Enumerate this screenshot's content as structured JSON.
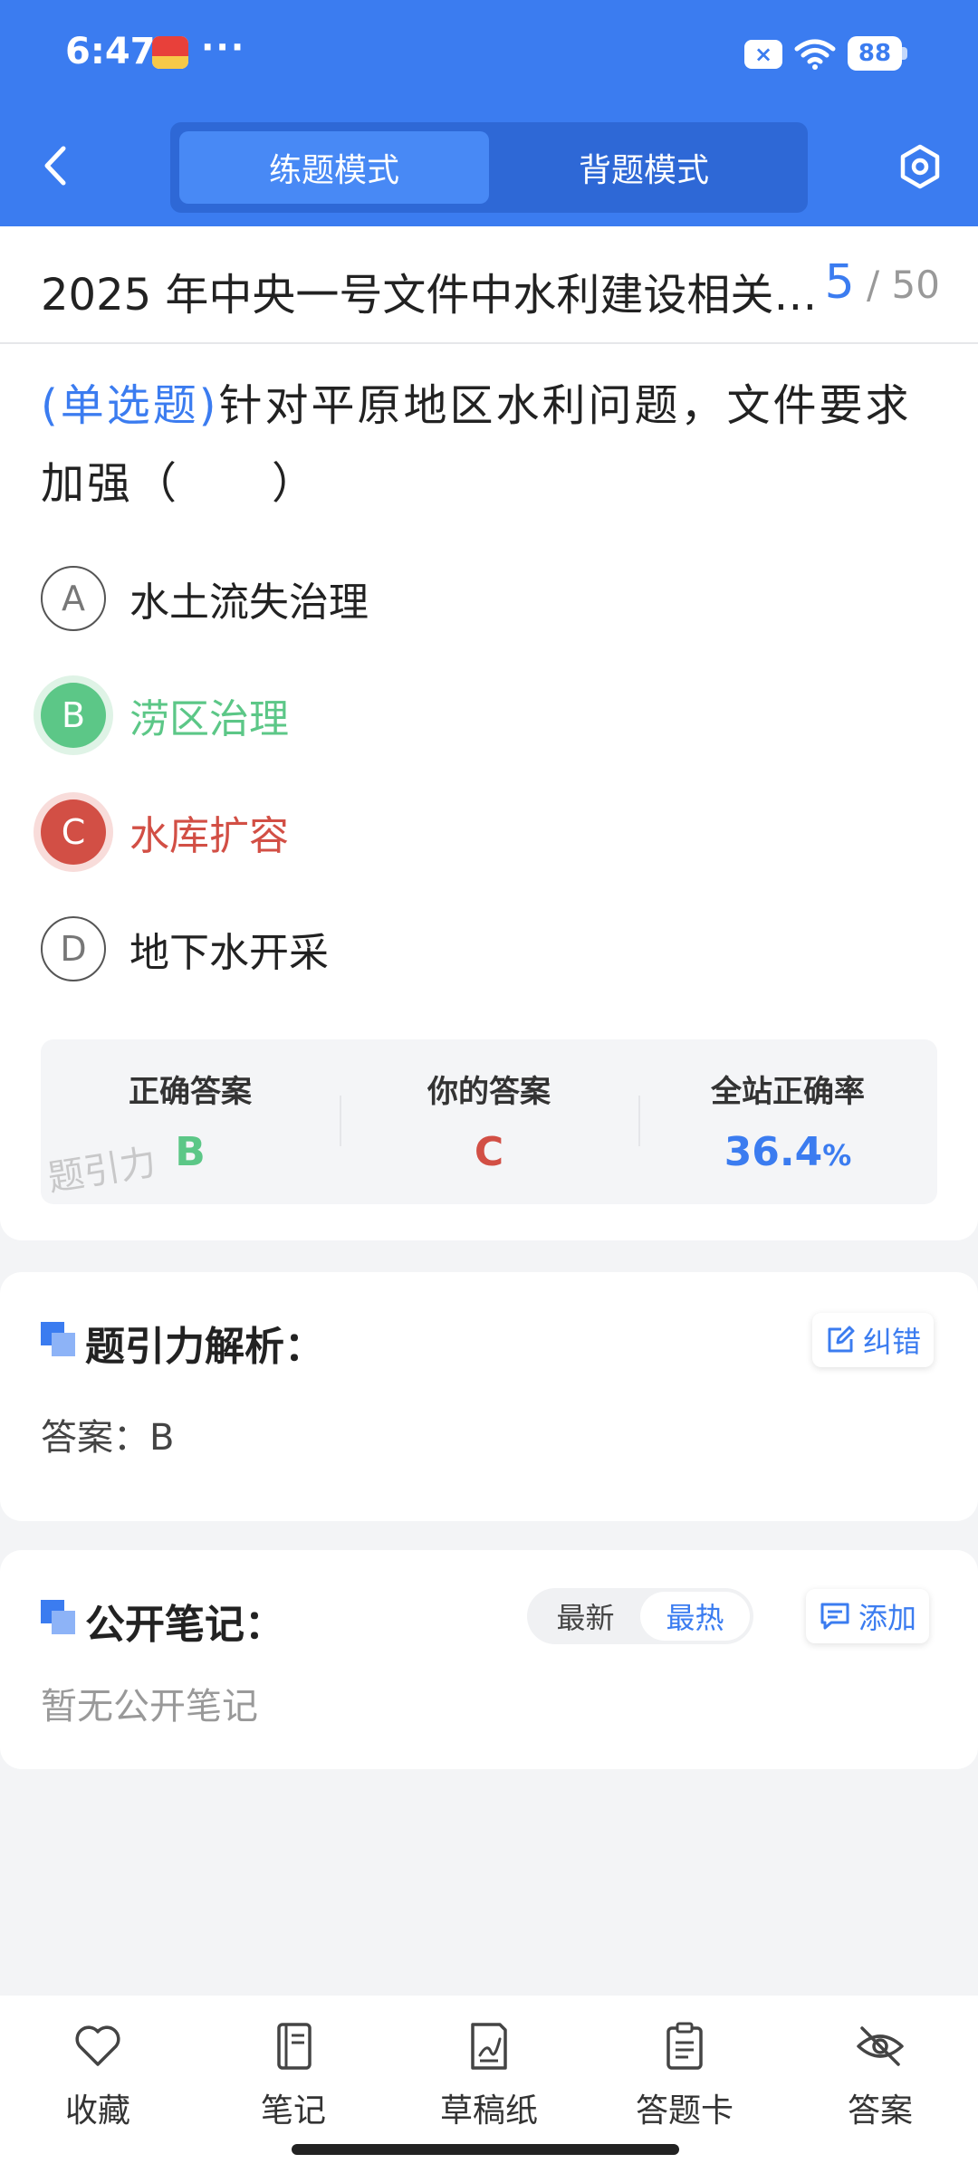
{
  "status_bar": {
    "time": "6:47",
    "dots": "···",
    "battery": "88",
    "close_mark": "×"
  },
  "header": {
    "tabs": [
      {
        "label": "练题模式",
        "active": true
      },
      {
        "label": "背题模式",
        "active": false
      }
    ]
  },
  "title_bar": {
    "title": "2025 年中央一号文件中水利建设相关…",
    "current": "5",
    "separator": "/",
    "total": "50"
  },
  "question": {
    "type": "(单选题)",
    "text": "针对平原地区水利问题，文件要求加强（　　）",
    "options": [
      {
        "letter": "A",
        "text": "水土流失治理",
        "state": "normal"
      },
      {
        "letter": "B",
        "text": "涝区治理",
        "state": "correct"
      },
      {
        "letter": "C",
        "text": "水库扩容",
        "state": "wrong"
      },
      {
        "letter": "D",
        "text": "地下水开采",
        "state": "normal"
      }
    ]
  },
  "stats": {
    "correct_label": "正确答案",
    "correct_value": "B",
    "yours_label": "你的答案",
    "yours_value": "C",
    "rate_label": "全站正确率",
    "rate_value": "36.4",
    "rate_unit": "%",
    "watermark": "题引力"
  },
  "analysis": {
    "title": "题引力解析：",
    "report_button": "纠错",
    "answer_text": "答案：B"
  },
  "notes": {
    "title": "公开笔记：",
    "sort_options": [
      "最新",
      "最热"
    ],
    "sort_active": "最热",
    "add_button": "添加",
    "empty_text": "暂无公开笔记"
  },
  "bottom_bar": {
    "items": [
      {
        "label": "收藏",
        "icon": "heart-icon"
      },
      {
        "label": "笔记",
        "icon": "notebook-icon"
      },
      {
        "label": "草稿纸",
        "icon": "draft-paper-icon"
      },
      {
        "label": "答题卡",
        "icon": "answer-card-icon"
      },
      {
        "label": "答案",
        "icon": "eye-off-icon"
      }
    ]
  },
  "colors": {
    "primary": "#3b7cf0",
    "correct": "#5cc787",
    "wrong": "#d24f45"
  }
}
